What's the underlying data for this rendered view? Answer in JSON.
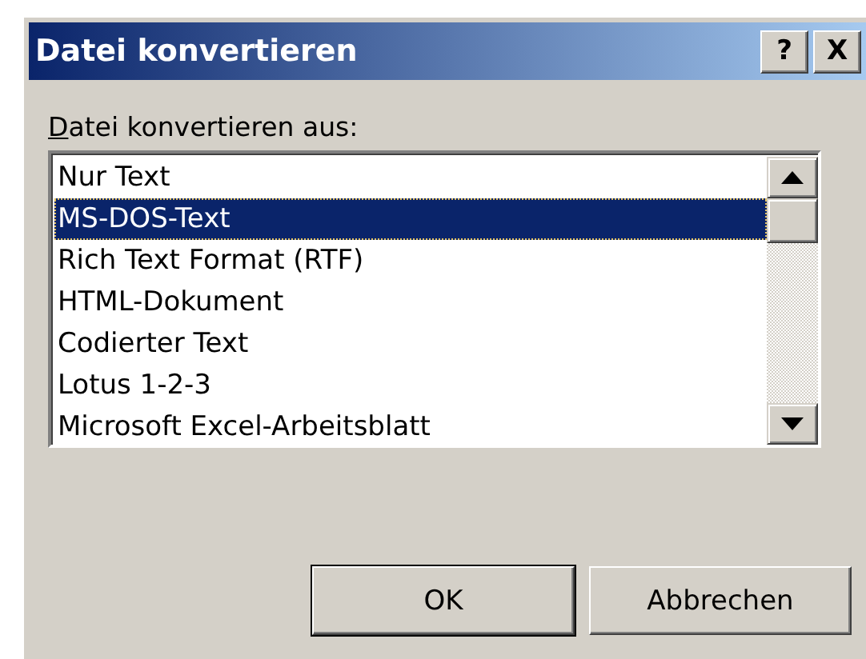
{
  "window": {
    "title": "Datei konvertieren",
    "title_buttons": [
      "?",
      "X"
    ]
  },
  "list_label": "Datei konvertieren aus:",
  "items": [
    {
      "label": "Nur Text",
      "selected": false
    },
    {
      "label": "MS-DOS-Text",
      "selected": true
    },
    {
      "label": "Rich Text Format (RTF)",
      "selected": false
    },
    {
      "label": "HTML-Dokument",
      "selected": false
    },
    {
      "label": "Codierter Text",
      "selected": false
    },
    {
      "label": "Lotus 1-2-3",
      "selected": false
    },
    {
      "label": "Microsoft Excel-Arbeitsblatt",
      "selected": false
    }
  ],
  "buttons": [
    {
      "label": "OK",
      "default": true
    },
    {
      "label": "Abbrechen",
      "default": false
    }
  ]
}
